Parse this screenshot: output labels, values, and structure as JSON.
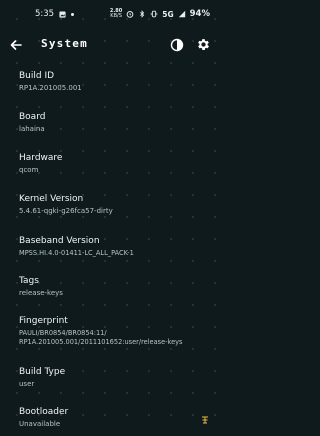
{
  "status_bar": {
    "time": "5:35",
    "net_speed_top": "2.80",
    "net_speed_bottom": "KB/S",
    "network": "5G",
    "battery": "94%"
  },
  "app_bar": {
    "title": "System"
  },
  "items": [
    {
      "label": "Build ID",
      "value": "RP1A.201005.001"
    },
    {
      "label": "Board",
      "value": "lahaina"
    },
    {
      "label": "Hardware",
      "value": "qcom"
    },
    {
      "label": "Kernel Version",
      "value": "5.4.61-qgki-g26fca57-dirty"
    },
    {
      "label": "Baseband Version",
      "value": "MPSS.HI.4.0-01411-LC_ALL_PACK-1"
    },
    {
      "label": "Tags",
      "value": "release-keys"
    },
    {
      "label": "Fingerprint",
      "value": "PAULI/BR0854/BR0854:11/",
      "value2": "RP1A.201005.001/2011101652:user/release-keys"
    },
    {
      "label": "Build Type",
      "value": "user"
    },
    {
      "label": "Bootloader",
      "value": "Unavailable"
    }
  ],
  "icons": {
    "back": "arrow-left-icon",
    "theme": "half-circle-icon",
    "settings": "gear-icon",
    "badge": "chinese-char-badge-icon"
  }
}
